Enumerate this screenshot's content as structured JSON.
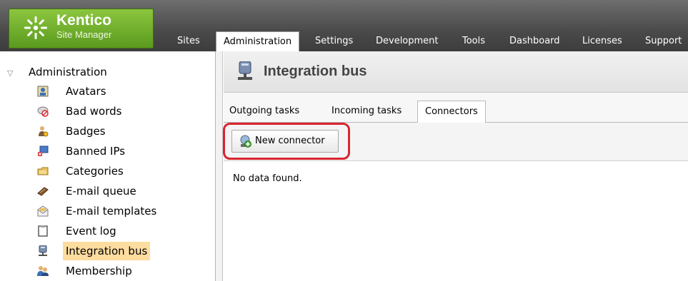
{
  "brand": {
    "name": "Kentico",
    "subtitle": "Site Manager",
    "logo_icon": "kentico-logo-icon",
    "accent": "#7bb531"
  },
  "nav": {
    "tabs": [
      {
        "label": "Sites",
        "active": false
      },
      {
        "label": "Administration",
        "active": true
      },
      {
        "label": "Settings",
        "active": false
      },
      {
        "label": "Development",
        "active": false
      },
      {
        "label": "Tools",
        "active": false
      },
      {
        "label": "Dashboard",
        "active": false
      },
      {
        "label": "Licenses",
        "active": false
      },
      {
        "label": "Support",
        "active": false
      }
    ]
  },
  "tree": {
    "root": {
      "label": "Administration",
      "icon": "collapse-caret-icon"
    },
    "items": [
      {
        "label": "Avatars",
        "icon": "avatar-icon",
        "selected": false
      },
      {
        "label": "Bad words",
        "icon": "bad-words-icon",
        "selected": false
      },
      {
        "label": "Badges",
        "icon": "badge-icon",
        "selected": false
      },
      {
        "label": "Banned IPs",
        "icon": "banned-ip-icon",
        "selected": false
      },
      {
        "label": "Categories",
        "icon": "category-icon",
        "selected": false
      },
      {
        "label": "E-mail queue",
        "icon": "email-queue-icon",
        "selected": false
      },
      {
        "label": "E-mail templates",
        "icon": "email-template-icon",
        "selected": false
      },
      {
        "label": "Event log",
        "icon": "event-log-icon",
        "selected": false
      },
      {
        "label": "Integration bus",
        "icon": "integration-bus-icon",
        "selected": true
      },
      {
        "label": "Membership",
        "icon": "membership-icon",
        "selected": false
      }
    ],
    "selected_color": "#fddca0"
  },
  "main": {
    "title": "Integration bus",
    "title_icon": "integration-bus-icon",
    "subtabs": [
      {
        "label": "Outgoing tasks",
        "active": false
      },
      {
        "label": "Incoming tasks",
        "active": false
      },
      {
        "label": "Connectors",
        "active": true
      }
    ],
    "toolbar": {
      "new_connector_label": "New connector",
      "new_connector_icon": "add-connector-icon",
      "highlight_color": "#d9252f"
    },
    "empty_message": "No data found."
  }
}
